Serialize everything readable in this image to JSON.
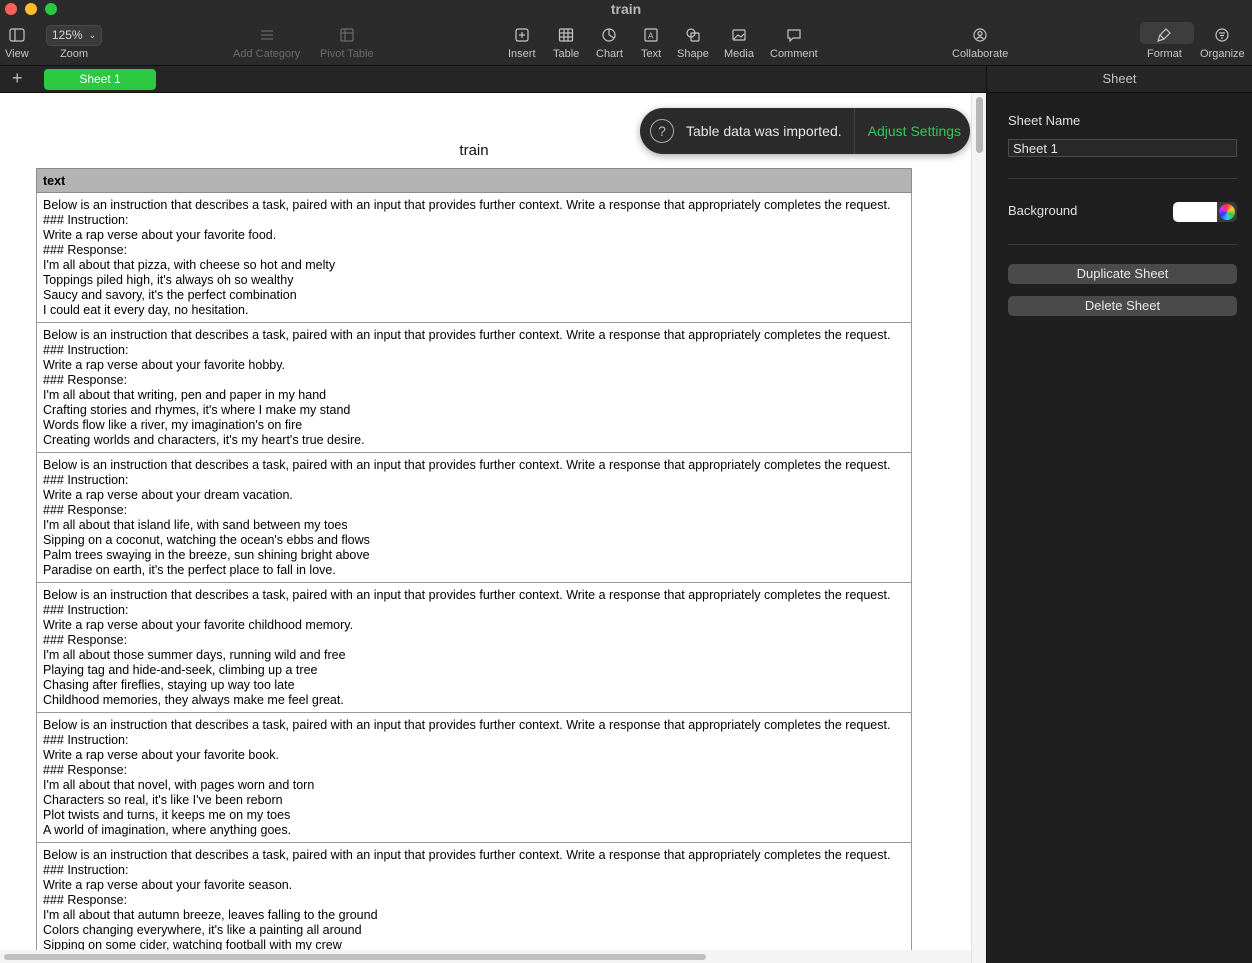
{
  "window": {
    "title": "train"
  },
  "toolbar": {
    "view": "View",
    "zoom_value": "125%",
    "zoom": "Zoom",
    "add_category": "Add Category",
    "pivot_table": "Pivot Table",
    "insert": "Insert",
    "table": "Table",
    "chart": "Chart",
    "text": "Text",
    "shape": "Shape",
    "media": "Media",
    "comment": "Comment",
    "collaborate": "Collaborate",
    "format": "Format",
    "organize": "Organize"
  },
  "tabs": {
    "add": "+",
    "sheets": [
      "Sheet 1"
    ]
  },
  "toast": {
    "message": "Table data was imported.",
    "action": "Adjust Settings",
    "icon": "?"
  },
  "table": {
    "title": "train",
    "header": "text",
    "rows": [
      [
        "Below is an instruction that describes a task, paired with an input that provides further context. Write a response that appropriately completes the request.",
        "### Instruction:",
        "Write a rap verse about your favorite food.",
        "### Response:",
        "I'm all about that pizza, with cheese so hot and melty",
        "Toppings piled high, it's always oh so wealthy",
        "Saucy and savory, it's the perfect combination",
        "I could eat it every day, no hesitation."
      ],
      [
        "Below is an instruction that describes a task, paired with an input that provides further context. Write a response that appropriately completes the request.",
        "### Instruction:",
        "Write a rap verse about your favorite hobby.",
        "### Response:",
        "I'm all about that writing, pen and paper in my hand",
        "Crafting stories and rhymes, it's where I make my stand",
        "Words flow like a river, my imagination's on fire",
        "Creating worlds and characters, it's my heart's true desire."
      ],
      [
        "Below is an instruction that describes a task, paired with an input that provides further context. Write a response that appropriately completes the request.",
        "### Instruction:",
        "Write a rap verse about your dream vacation.",
        "### Response:",
        "I'm all about that island life, with sand between my toes",
        "Sipping on a coconut, watching the ocean's ebbs and flows",
        "Palm trees swaying in the breeze, sun shining bright above",
        "Paradise on earth, it's the perfect place to fall in love."
      ],
      [
        "Below is an instruction that describes a task, paired with an input that provides further context. Write a response that appropriately completes the request.",
        "### Instruction:",
        "Write a rap verse about your favorite childhood memory.",
        "### Response:",
        "I'm all about those summer days, running wild and free",
        "Playing tag and hide-and-seek, climbing up a tree",
        "Chasing after fireflies, staying up way too late",
        "Childhood memories, they always make me feel great."
      ],
      [
        "Below is an instruction that describes a task, paired with an input that provides further context. Write a response that appropriately completes the request.",
        "### Instruction:",
        "Write a rap verse about your favorite book.",
        "### Response:",
        "I'm all about that novel, with pages worn and torn",
        "Characters so real, it's like I've been reborn",
        "Plot twists and turns, it keeps me on my toes",
        "A world of imagination, where anything goes."
      ],
      [
        "Below is an instruction that describes a task, paired with an input that provides further context. Write a response that appropriately completes the request.",
        "### Instruction:",
        "Write a rap verse about your favorite season.",
        "### Response:",
        "I'm all about that autumn breeze, leaves falling to the ground",
        "Colors changing everywhere, it's like a painting all around",
        "Sipping on some cider, watching football with my crew"
      ]
    ]
  },
  "inspector": {
    "header": "Sheet",
    "sheet_name_label": "Sheet Name",
    "sheet_name_value": "Sheet 1",
    "background_label": "Background",
    "background_color": "#ffffff",
    "duplicate": "Duplicate Sheet",
    "delete": "Delete Sheet"
  },
  "colors": {
    "accent": "#2ac940",
    "toast_action": "#34c759"
  }
}
